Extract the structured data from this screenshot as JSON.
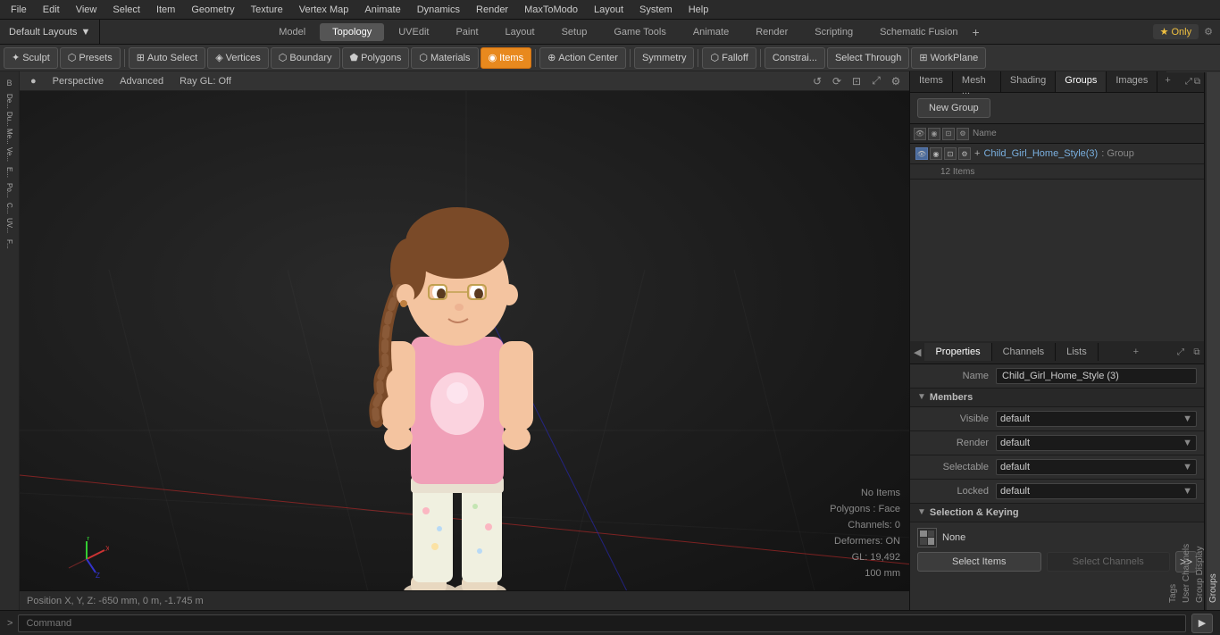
{
  "menu": {
    "items": [
      "File",
      "Edit",
      "View",
      "Select",
      "Item",
      "Geometry",
      "Texture",
      "Vertex Map",
      "Animate",
      "Dynamics",
      "Render",
      "MaxToModo",
      "Layout",
      "System",
      "Help"
    ]
  },
  "layout_bar": {
    "dropdown_label": "Default Layouts",
    "tabs": [
      "Model",
      "Topology",
      "UVEdit",
      "Paint",
      "Layout",
      "Setup",
      "Game Tools",
      "Animate",
      "Render",
      "Scripting",
      "Schematic Fusion"
    ],
    "active_tab": "Topology",
    "star_label": "★  Only",
    "plus_icon": "+"
  },
  "toolbar": {
    "sculpt_label": "Sculpt",
    "presets_label": "Presets",
    "auto_select_label": "Auto Select",
    "vertices_label": "Vertices",
    "boundary_label": "Boundary",
    "polygons_label": "Polygons",
    "materials_label": "Materials",
    "items_label": "Items",
    "action_center_label": "Action Center",
    "symmetry_label": "Symmetry",
    "falloff_label": "Falloff",
    "constrai_label": "Constrai...",
    "select_through_label": "Select Through",
    "workplane_label": "WorkPlane"
  },
  "viewport": {
    "mode_label": "Perspective",
    "quality_label": "Advanced",
    "render_label": "Ray GL: Off",
    "status": {
      "no_items": "No Items",
      "polygons": "Polygons : Face",
      "channels": "Channels: 0",
      "deformers": "Deformers: ON",
      "gl": "GL: 19,492",
      "size": "100 mm"
    }
  },
  "viewport_footer": {
    "position": "Position X, Y, Z:  -650 mm, 0 m, -1.745 m"
  },
  "right_panel": {
    "tabs": [
      "Items",
      "Mesh ...",
      "Shading",
      "Groups",
      "Images"
    ],
    "active_tab": "Groups",
    "new_group_btn": "New Group",
    "col_headers": {
      "name_col": "Name"
    },
    "group": {
      "name": "Child_Girl_Home_Style",
      "suffix": "(3)",
      "tag": ": Group",
      "count": "12 Items"
    }
  },
  "properties": {
    "tabs": [
      "Properties",
      "Channels",
      "Lists"
    ],
    "active_tab": "Properties",
    "name_label": "Name",
    "name_value": "Child_Girl_Home_Style (3)",
    "members_label": "Members",
    "visible_label": "Visible",
    "visible_value": "default",
    "render_label": "Render",
    "render_value": "default",
    "selectable_label": "Selectable",
    "selectable_value": "default",
    "locked_label": "Locked",
    "locked_value": "default",
    "selection_keying_label": "Selection & Keying",
    "none_label": "None",
    "select_items_btn": "Select Items",
    "select_channels_btn": "Select Channels"
  },
  "vtabs": {
    "items": [
      "Groups",
      "Group Display",
      "User Channels",
      "Tags"
    ]
  },
  "cmd_bar": {
    "prompt_label": ">",
    "command_placeholder": "Command"
  },
  "icons": {
    "eye": "👁",
    "lock": "🔒",
    "render": "◉",
    "expand": "▶",
    "collapse": "▼",
    "dropdown_arrow": "▼",
    "add": "+",
    "settings": "⚙",
    "grid": "⋮⋮"
  }
}
